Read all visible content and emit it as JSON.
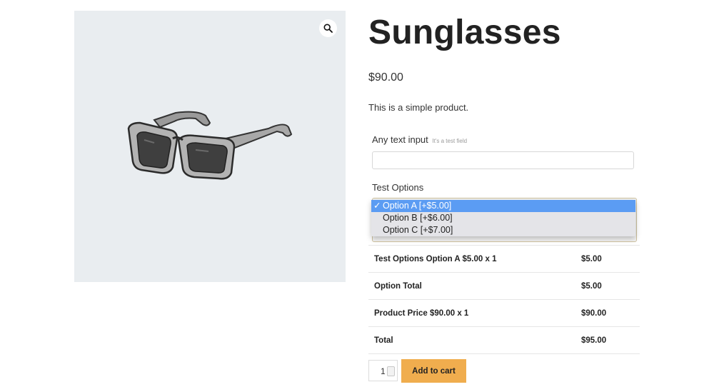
{
  "product": {
    "title": "Sunglasses",
    "price": "$90.00",
    "description": "This is a simple product."
  },
  "image": {
    "icon": "sunglasses-illustration",
    "zoom_icon": "magnifier-icon"
  },
  "text_field": {
    "label": "Any text input",
    "hint": "It's a test field",
    "value": ""
  },
  "options_field": {
    "label": "Test Options",
    "selected": "Option A [+$5.00]",
    "options": [
      {
        "label": "Option A [+$5.00]",
        "selected": true
      },
      {
        "label": "Option B [+$6.00]",
        "selected": false
      },
      {
        "label": "Option C [+$7.00]",
        "selected": false
      }
    ],
    "checkmark": "✓"
  },
  "totals": [
    {
      "label": "Test Options Option A $5.00 x 1",
      "amount": "$5.00"
    },
    {
      "label": "Option Total",
      "amount": "$5.00"
    },
    {
      "label": "Product Price $90.00 x 1",
      "amount": "$90.00"
    },
    {
      "label": "Total",
      "amount": "$95.00"
    }
  ],
  "cart": {
    "quantity": "1",
    "button_label": "Add to cart"
  },
  "colors": {
    "accent": "#f0ad4e",
    "selected_option": "#5b9cf3",
    "image_bg": "#e9edf0"
  }
}
